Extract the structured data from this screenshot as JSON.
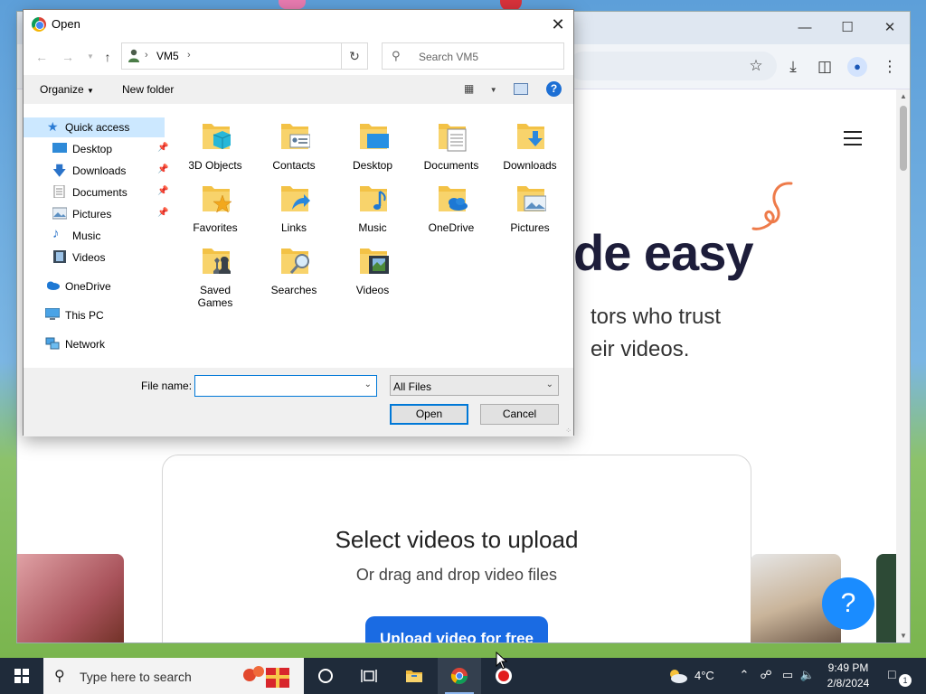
{
  "dialog": {
    "title": "Open",
    "address": {
      "segment": "VM5"
    },
    "search_placeholder": "Search VM5",
    "commands": {
      "organize": "Organize",
      "new_folder": "New folder"
    },
    "nav": {
      "quick_access": "Quick access",
      "desktop": "Desktop",
      "downloads": "Downloads",
      "documents": "Documents",
      "pictures": "Pictures",
      "music": "Music",
      "videos": "Videos",
      "onedrive": "OneDrive",
      "this_pc": "This PC",
      "network": "Network"
    },
    "files": {
      "objects3d": "3D Objects",
      "contacts": "Contacts",
      "desktop": "Desktop",
      "documents": "Documents",
      "downloads": "Downloads",
      "favorites": "Favorites",
      "links": "Links",
      "music": "Music",
      "onedrive": "OneDrive",
      "pictures": "Pictures",
      "saved_games_1": "Saved",
      "saved_games_2": "Games",
      "searches": "Searches",
      "videos": "Videos"
    },
    "file_name_label": "File name:",
    "file_name_value": "",
    "file_type": "All Files",
    "open_button": "Open",
    "cancel_button": "Cancel"
  },
  "webpage": {
    "hero_title": "de easy",
    "hero_sub_line1": "tors who trust",
    "hero_sub_line2": "eir videos.",
    "upload_title": "Select videos to upload",
    "upload_sub": "Or drag and drop video files",
    "upload_button": "Upload video for free",
    "help_label": "?"
  },
  "taskbar": {
    "search_placeholder": "Type here to search",
    "temperature": "4°C",
    "time": "9:49 PM",
    "date": "2/8/2024",
    "notification_count": "1"
  },
  "colors": {
    "accent_blue": "#0078d7",
    "upload_button": "#1a6be3",
    "help_bubble": "#1a8cff",
    "taskbar": "#1f2b3a"
  }
}
